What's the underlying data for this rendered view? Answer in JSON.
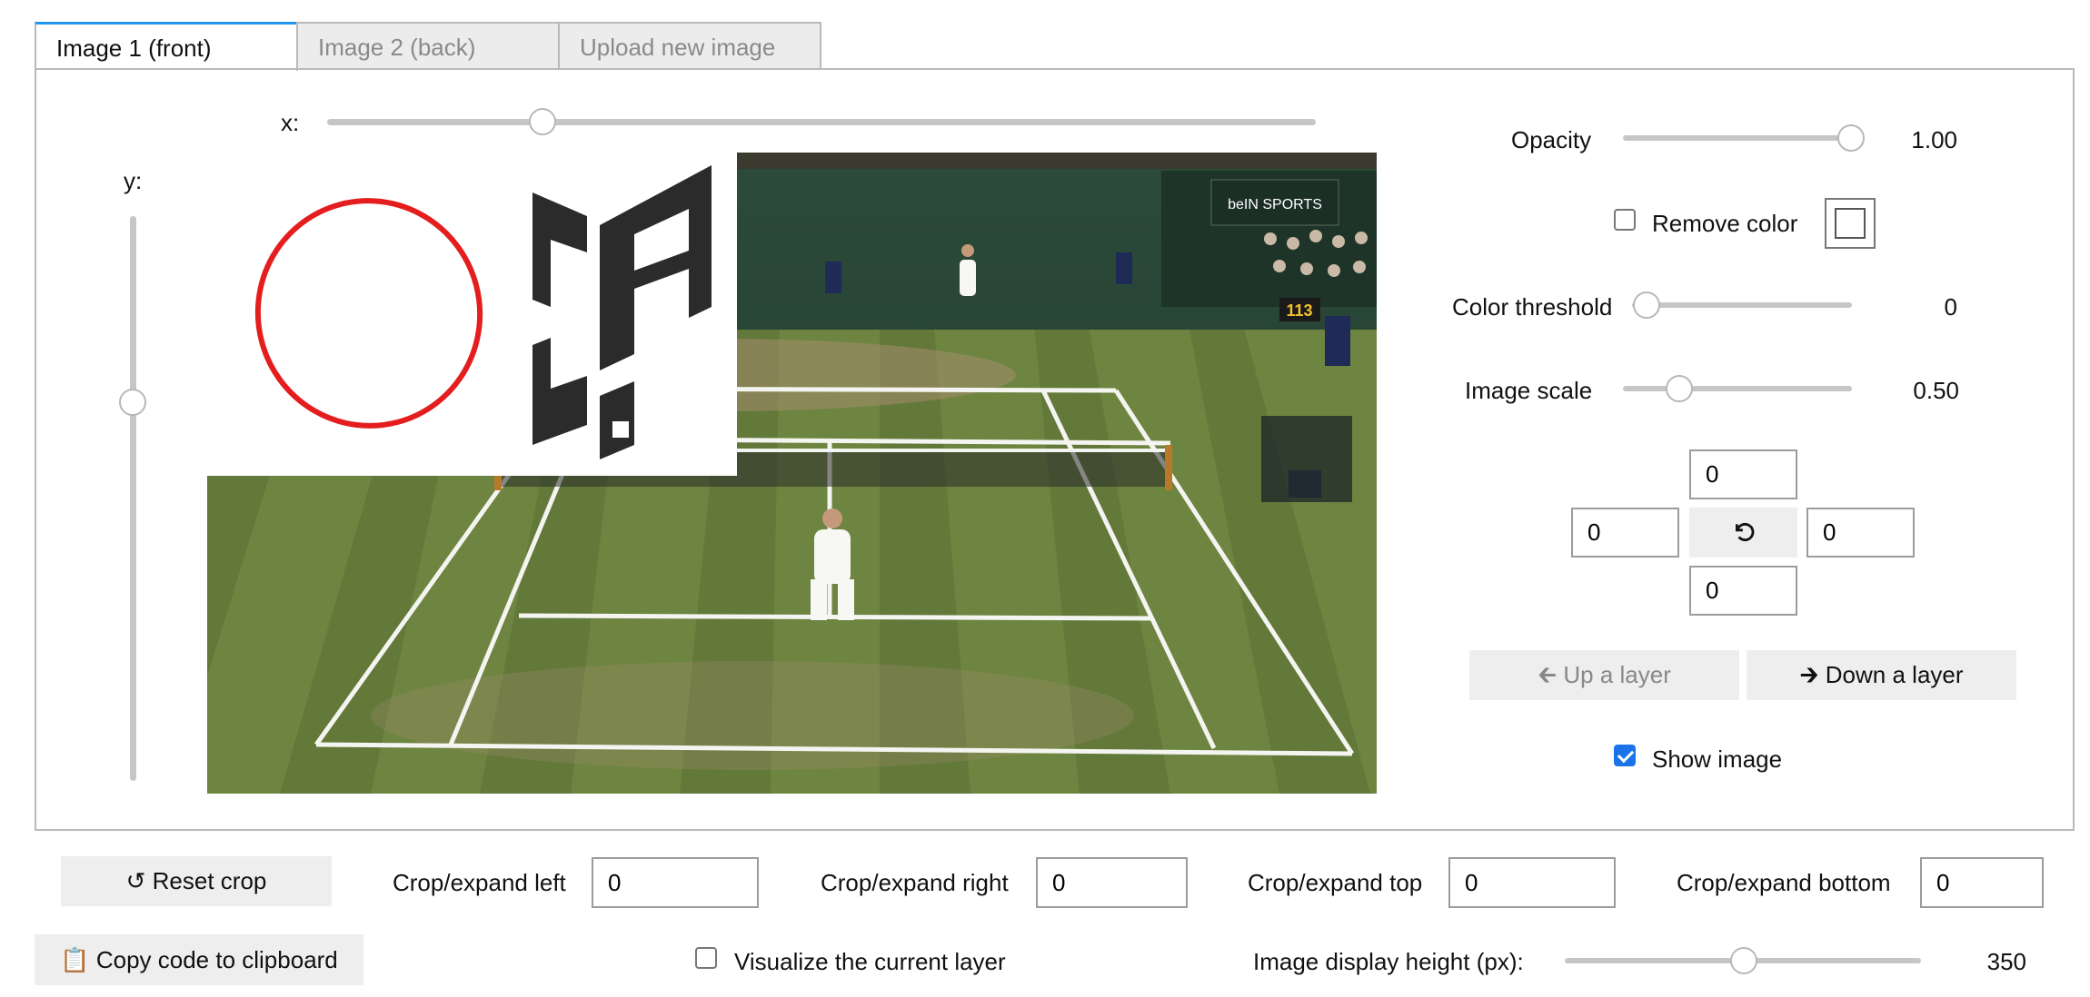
{
  "tabs": [
    {
      "label": "Image 1 (front)",
      "active": true
    },
    {
      "label": "Image 2 (back)",
      "active": false
    },
    {
      "label": "Upload new image",
      "active": false
    }
  ],
  "canvas": {
    "x_label": "x:",
    "y_label": "y:",
    "x_slider_value": 0.22,
    "y_slider_value": 0.33
  },
  "controls": {
    "opacity": {
      "label": "Opacity",
      "value": "1.00",
      "fraction": 1.0
    },
    "remove_color": {
      "label": "Remove color",
      "checked": false
    },
    "color_threshold": {
      "label": "Color threshold",
      "value": "0",
      "fraction": 0.0
    },
    "image_scale": {
      "label": "Image scale",
      "value": "0.50",
      "fraction": 0.25
    },
    "offsets": {
      "top": "0",
      "left": "0",
      "right": "0",
      "bottom": "0"
    },
    "up_layer_label": "Up a layer",
    "down_layer_label": "Down a layer",
    "show_image": {
      "label": "Show image",
      "checked": true
    }
  },
  "crop": {
    "reset_label": "Reset crop",
    "left": {
      "label": "Crop/expand left",
      "value": "0"
    },
    "right": {
      "label": "Crop/expand right",
      "value": "0"
    },
    "top": {
      "label": "Crop/expand top",
      "value": "0"
    },
    "bottom": {
      "label": "Crop/expand bottom",
      "value": "0"
    }
  },
  "footer": {
    "copy_label": "Copy code to clipboard",
    "visualize": {
      "label": "Visualize the current layer",
      "checked": false
    },
    "display_height": {
      "label": "Image display height (px):",
      "value": "350",
      "fraction": 0.5
    }
  },
  "scoreboard": {
    "score": "113",
    "brand": "beIN SPORTS"
  },
  "colors": {
    "accent": "#2196f3",
    "checkbox": "#1a73e8",
    "grass_dark": "#5f7a3a",
    "grass_light": "#7a9247",
    "circle": "#e41e1e",
    "logo": "#2b2b2b"
  }
}
